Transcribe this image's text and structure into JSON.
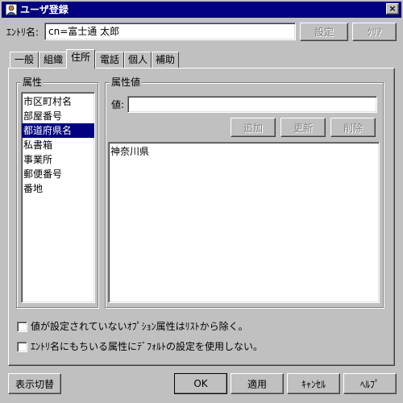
{
  "window": {
    "title": "ユーザ登録",
    "close_label": "×"
  },
  "entry": {
    "label": "ｴﾝﾄﾘ名:",
    "value": "cn=富士通 太郎"
  },
  "top_buttons": {
    "settings": "設定",
    "clear": "ｸﾘｱ"
  },
  "tabs": [
    {
      "label": "一般"
    },
    {
      "label": "組織"
    },
    {
      "label": "住所"
    },
    {
      "label": "電話"
    },
    {
      "label": "個人"
    },
    {
      "label": "補助"
    }
  ],
  "attributes": {
    "group_label": "属性",
    "items": [
      "市区町村名",
      "部屋番号",
      "都道府県名",
      "私書箱",
      "事業所",
      "郵便番号",
      "番地"
    ],
    "selected": "都道府県名"
  },
  "attribute_values": {
    "group_label": "属性値",
    "value_label": "値:",
    "value_input": "",
    "add_label": "追加",
    "update_label": "更新",
    "delete_label": "削除",
    "items": [
      "神奈川県"
    ]
  },
  "options": {
    "exclude_unset_optional": "値が設定されていないｵﾌﾟｼｮﾝ属性はﾘｽﾄから除く。",
    "no_default_for_entry_attrs": "ｴﾝﾄﾘ名にもちいる属性にﾃﾞﾌｫﾙﾄの設定を使用しない。"
  },
  "bottom_buttons": {
    "toggle_view": "表示切替",
    "ok": "OK",
    "apply": "適用",
    "cancel": "ｷｬﾝｾﾙ",
    "help": "ﾍﾙﾌﾟ"
  },
  "colors": {
    "titlebar": "#000080",
    "face": "#c0c0c0",
    "selection": "#000080"
  }
}
